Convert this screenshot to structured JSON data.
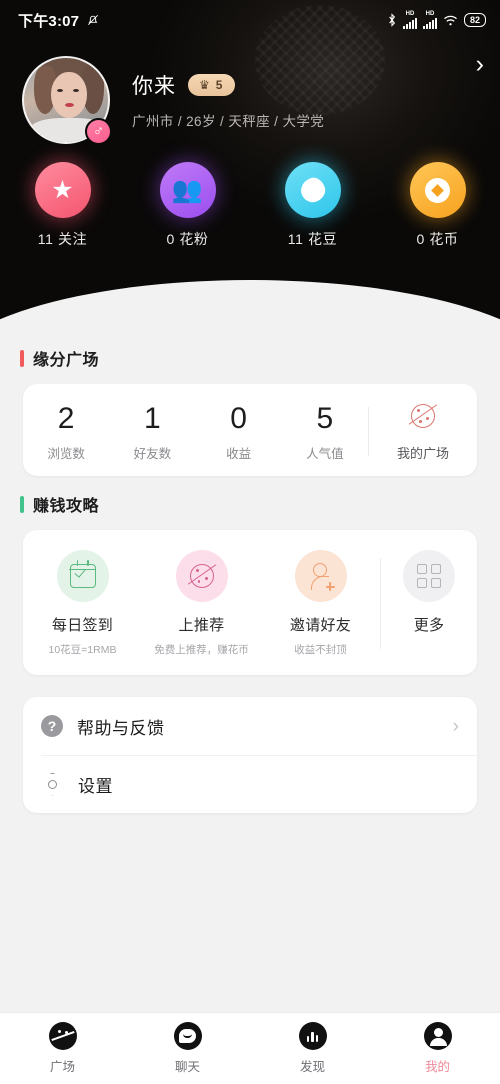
{
  "status_bar": {
    "time": "下午3:07",
    "mute_icon": "bell-muted-icon",
    "bluetooth_icon": "bluetooth-icon",
    "hd_label_1": "HD",
    "hd_label_2": "HD",
    "wifi_icon": "wifi-icon",
    "battery": "82"
  },
  "profile": {
    "name": "你来",
    "level_badge": "5",
    "crown_icon": "crown-icon",
    "gender_icon": "♂",
    "meta": "广州市 / 26岁 / 天秤座 / 大学党",
    "chevron": "›"
  },
  "header_stats": [
    {
      "value": "11 关注",
      "icon": "star-icon",
      "color": "#f4556f"
    },
    {
      "value": "0 花粉",
      "icon": "people-icon",
      "color": "#9b4ef0"
    },
    {
      "value": "11 花豆",
      "icon": "bean-icon",
      "color": "#2ec6ea"
    },
    {
      "value": "0 花币",
      "icon": "coin-icon",
      "color": "#f7a21f"
    }
  ],
  "plaza_section": {
    "title": "缘分广场",
    "accent": "#f05a5a",
    "stats": [
      {
        "value": "2",
        "label": "浏览数"
      },
      {
        "value": "1",
        "label": "好友数"
      },
      {
        "value": "0",
        "label": "收益"
      },
      {
        "value": "5",
        "label": "人气值"
      }
    ],
    "entry": {
      "label": "我的广场",
      "icon": "planet-icon",
      "color": "#d9756f"
    }
  },
  "earn_section": {
    "title": "赚钱攻略",
    "accent": "#3fc38a",
    "items": [
      {
        "label": "每日签到",
        "sub": "10花豆=1RMB",
        "icon": "calendar-check-icon",
        "color": "#5cb97f"
      },
      {
        "label": "上推荐",
        "sub": "免费上推荐，赚花币",
        "icon": "planet-icon",
        "color": "#d9608f"
      },
      {
        "label": "邀请好友",
        "sub": "收益不封顶",
        "icon": "person-add-icon",
        "color": "#f0a071"
      }
    ],
    "more": {
      "label": "更多",
      "icon": "grid-icon"
    }
  },
  "menu": [
    {
      "label": "帮助与反馈",
      "icon": "question-circle-icon",
      "chevron": "›"
    },
    {
      "label": "设置",
      "icon": "settings-hex-icon",
      "chevron": ""
    }
  ],
  "tabbar": {
    "active_color": "#f08a9a",
    "items": [
      {
        "label": "广场",
        "icon": "planet-icon"
      },
      {
        "label": "聊天",
        "icon": "chat-icon"
      },
      {
        "label": "发现",
        "icon": "discover-chart-icon"
      },
      {
        "label": "我的",
        "icon": "profile-icon"
      }
    ]
  }
}
